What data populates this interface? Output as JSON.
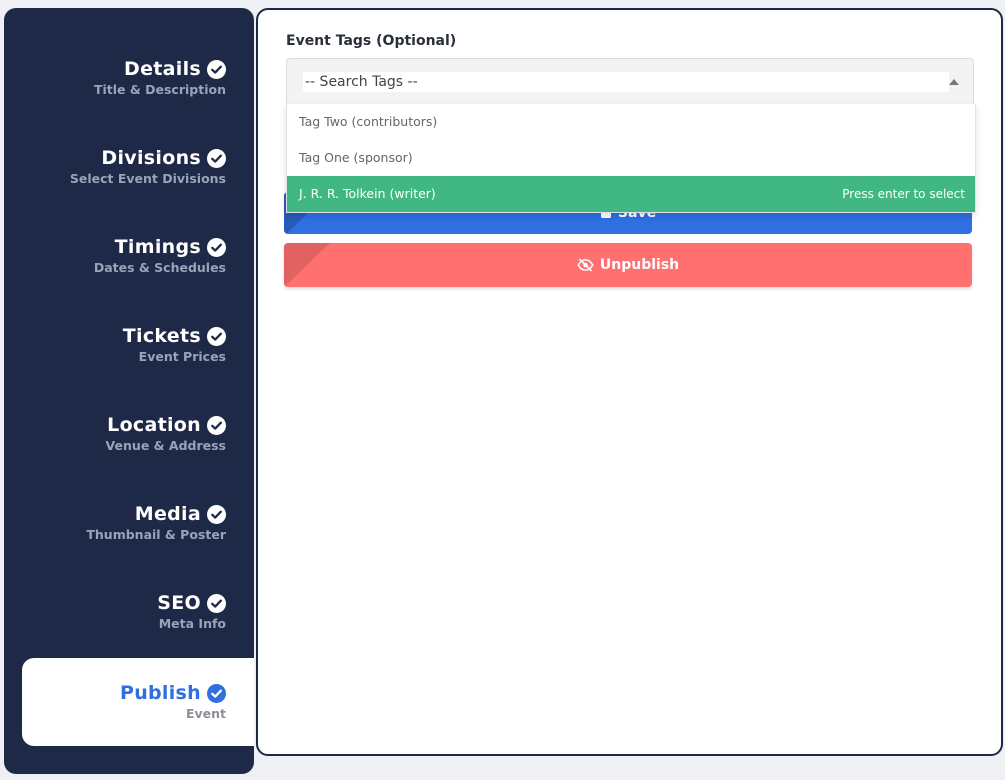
{
  "sidebar": {
    "steps": [
      {
        "title": "Details",
        "subtitle": "Title & Description"
      },
      {
        "title": "Divisions",
        "subtitle": "Select Event Divisions"
      },
      {
        "title": "Timings",
        "subtitle": "Dates & Schedules"
      },
      {
        "title": "Tickets",
        "subtitle": "Event Prices"
      },
      {
        "title": "Location",
        "subtitle": "Venue & Address"
      },
      {
        "title": "Media",
        "subtitle": "Thumbnail & Poster"
      },
      {
        "title": "SEO",
        "subtitle": "Meta Info"
      },
      {
        "title": "Publish",
        "subtitle": "Event"
      }
    ]
  },
  "form": {
    "tags_label": "Event Tags (Optional)",
    "search_placeholder": "-- Search Tags --",
    "options": [
      {
        "label": "Tag Two (contributors)"
      },
      {
        "label": "Tag One (sponsor)"
      },
      {
        "label": "J. R. R. Tolkein (writer)"
      }
    ],
    "select_hint": "Press enter to select",
    "save_label": "Save",
    "unpublish_label": "Unpublish"
  },
  "colors": {
    "sidebar_bg": "#1e2847",
    "accent_blue": "#2f6fe0",
    "highlight_green": "#41b883",
    "unpublish_red": "#ff7070"
  }
}
